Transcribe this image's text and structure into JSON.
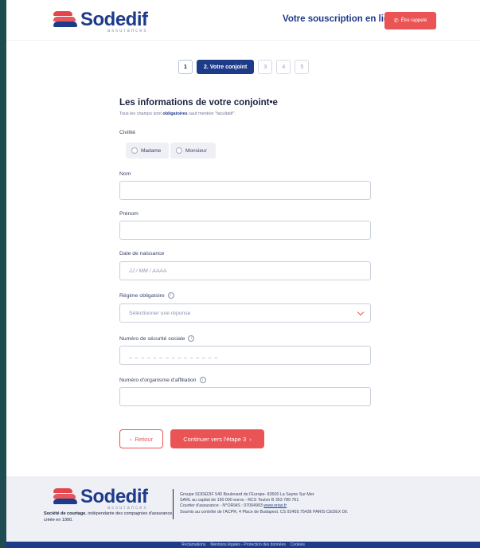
{
  "header": {
    "logo_name": "Sodedif",
    "logo_sub": "assurances",
    "title": "Votre souscription en ligne",
    "call_button": "Être rappelé"
  },
  "steps": [
    "1",
    "2. Votre conjoint",
    "3",
    "4",
    "5"
  ],
  "form": {
    "title": "Les informations de votre conjoint•e",
    "hint_prefix": "Tous les champs sont ",
    "hint_bold": "obligatoires",
    "hint_suffix": " sauf mention \"facultatif\".",
    "civilite": {
      "label": "Civilité",
      "options": [
        "Madame",
        "Monsieur"
      ]
    },
    "nom": {
      "label": "Nom",
      "value": ""
    },
    "prenom": {
      "label": "Prénom",
      "value": ""
    },
    "naissance": {
      "label": "Date de naissance",
      "placeholder": "JJ  /  MM  /  AAAA"
    },
    "regime": {
      "label": "Régime obligatoire",
      "placeholder": "Sélectionner une réponse"
    },
    "secu": {
      "label": "Numéro de sécurité sociale",
      "placeholder": "_ _ _ _ _ _ _ _ _ _ _ _ _     _ _"
    },
    "organisme": {
      "label": "Numéro d'organisme d'affiliation",
      "value": ""
    }
  },
  "actions": {
    "back": "Retour",
    "next": "Continuer vers l'étape 3"
  },
  "footer": {
    "tag_bold": "Société de courtage",
    "tag_rest": ", indépendante des compagnies d'assurance, créée en 1990.",
    "info": [
      "Groupe SODEDIF 540 Boulevard de l'Europe- 83500 La Seyne Sur Mer",
      "SARL au capital de 150 000 euros - RCS Toulon B 353 789 761",
      "Courtier d'assurance - N°ORIAS : 07004993 ",
      "Soumis au contrôle de l'ACPR, 4 Place de Budapest. CS 92459.75436 PARIS CEDEX 09."
    ],
    "orias_link": "www.orias.fr",
    "links": [
      "Réclamations",
      "Mentions légales - Protection des données",
      "Cookies"
    ]
  }
}
